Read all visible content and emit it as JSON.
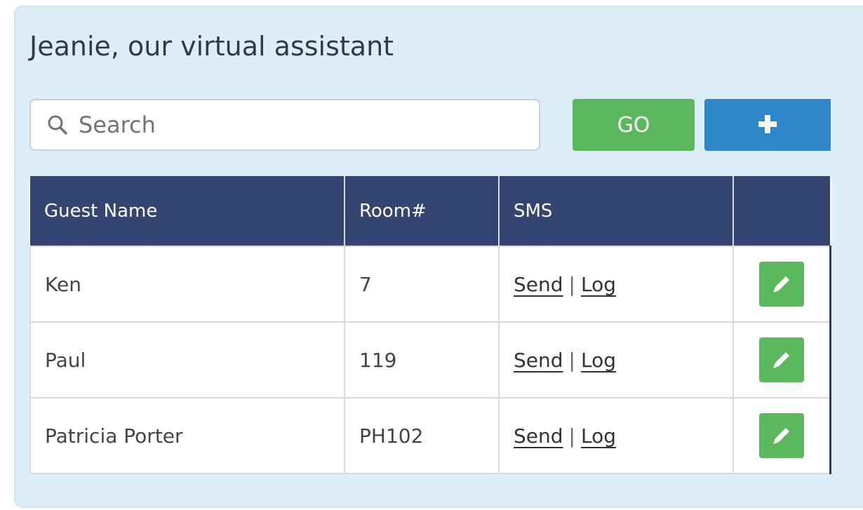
{
  "panel": {
    "title": "Jeanie, our virtual assistant"
  },
  "search": {
    "placeholder": "Search",
    "value": ""
  },
  "toolbar": {
    "go_label": "GO",
    "add_icon": "plus-icon"
  },
  "table": {
    "columns": [
      "Guest Name",
      "Room#",
      "SMS",
      ""
    ],
    "rows": [
      {
        "guest_name": "Ken",
        "room": "7",
        "sms_send": "Send",
        "sms_sep": "|",
        "sms_log": "Log",
        "action_icon": "pencil-icon"
      },
      {
        "guest_name": "Paul",
        "room": "119",
        "sms_send": "Send",
        "sms_sep": "|",
        "sms_log": "Log",
        "action_icon": "pencil-icon"
      },
      {
        "guest_name": "Patricia Porter",
        "room": "PH102",
        "sms_send": "Send",
        "sms_sep": "|",
        "sms_log": "Log",
        "action_icon": "pencil-icon"
      }
    ]
  },
  "colors": {
    "panel_bg": "#ddeef9",
    "header_bg": "#344571",
    "go_green": "#5cb85c",
    "add_blue": "#2f86c8",
    "edit_green": "#5cb85c"
  }
}
